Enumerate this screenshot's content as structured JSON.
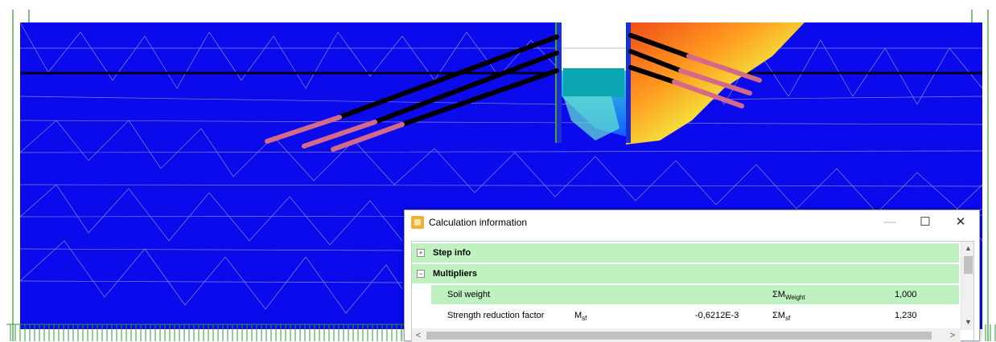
{
  "window": {
    "title": "Calculation information",
    "minimize_label": "—",
    "maximize_label": "☐",
    "close_label": "✕"
  },
  "sections": [
    {
      "label": "Step info",
      "expander": "+"
    },
    {
      "label": "Multipliers",
      "expander": "−"
    }
  ],
  "multipliers": [
    {
      "name": "Soil weight",
      "symbol": "",
      "symbol_sub": "",
      "value": "",
      "sum_symbol": "ΣM",
      "sum_sub": "Weight",
      "sum_value": "1,000"
    },
    {
      "name": "Strength reduction factor",
      "symbol": "M",
      "symbol_sub": "sf",
      "value": "-0,6212E-3",
      "sum_symbol": "ΣM",
      "sum_sub": "sf",
      "sum_value": "1,230"
    }
  ],
  "scroll_labels": {
    "up": "▲",
    "down": "▼",
    "left": "<",
    "right": ">"
  },
  "colors": {
    "soil": "#0a0aec",
    "mesh": "#9a9ad6",
    "anchor": "#000000",
    "grout": "#d46a8a",
    "plate": "#1a2fd0",
    "row_highlight": "#bff2c0"
  }
}
